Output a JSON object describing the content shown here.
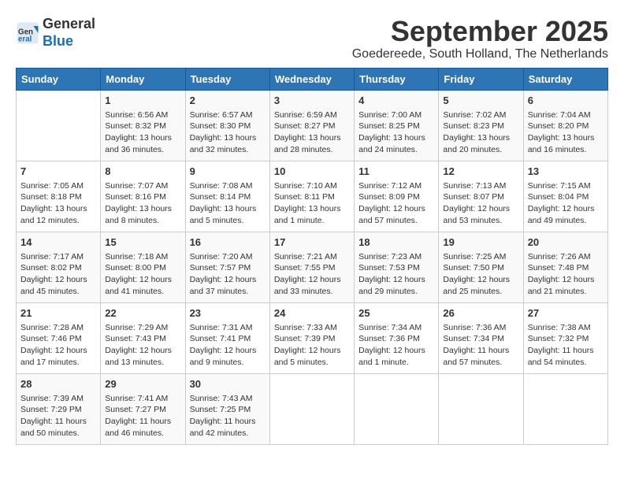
{
  "logo": {
    "general": "General",
    "blue": "Blue"
  },
  "header": {
    "month": "September 2025",
    "location": "Goedereede, South Holland, The Netherlands"
  },
  "weekdays": [
    "Sunday",
    "Monday",
    "Tuesday",
    "Wednesday",
    "Thursday",
    "Friday",
    "Saturday"
  ],
  "weeks": [
    [
      {
        "day": "",
        "info": ""
      },
      {
        "day": "1",
        "info": "Sunrise: 6:56 AM\nSunset: 8:32 PM\nDaylight: 13 hours\nand 36 minutes."
      },
      {
        "day": "2",
        "info": "Sunrise: 6:57 AM\nSunset: 8:30 PM\nDaylight: 13 hours\nand 32 minutes."
      },
      {
        "day": "3",
        "info": "Sunrise: 6:59 AM\nSunset: 8:27 PM\nDaylight: 13 hours\nand 28 minutes."
      },
      {
        "day": "4",
        "info": "Sunrise: 7:00 AM\nSunset: 8:25 PM\nDaylight: 13 hours\nand 24 minutes."
      },
      {
        "day": "5",
        "info": "Sunrise: 7:02 AM\nSunset: 8:23 PM\nDaylight: 13 hours\nand 20 minutes."
      },
      {
        "day": "6",
        "info": "Sunrise: 7:04 AM\nSunset: 8:20 PM\nDaylight: 13 hours\nand 16 minutes."
      }
    ],
    [
      {
        "day": "7",
        "info": "Sunrise: 7:05 AM\nSunset: 8:18 PM\nDaylight: 13 hours\nand 12 minutes."
      },
      {
        "day": "8",
        "info": "Sunrise: 7:07 AM\nSunset: 8:16 PM\nDaylight: 13 hours\nand 8 minutes."
      },
      {
        "day": "9",
        "info": "Sunrise: 7:08 AM\nSunset: 8:14 PM\nDaylight: 13 hours\nand 5 minutes."
      },
      {
        "day": "10",
        "info": "Sunrise: 7:10 AM\nSunset: 8:11 PM\nDaylight: 13 hours\nand 1 minute."
      },
      {
        "day": "11",
        "info": "Sunrise: 7:12 AM\nSunset: 8:09 PM\nDaylight: 12 hours\nand 57 minutes."
      },
      {
        "day": "12",
        "info": "Sunrise: 7:13 AM\nSunset: 8:07 PM\nDaylight: 12 hours\nand 53 minutes."
      },
      {
        "day": "13",
        "info": "Sunrise: 7:15 AM\nSunset: 8:04 PM\nDaylight: 12 hours\nand 49 minutes."
      }
    ],
    [
      {
        "day": "14",
        "info": "Sunrise: 7:17 AM\nSunset: 8:02 PM\nDaylight: 12 hours\nand 45 minutes."
      },
      {
        "day": "15",
        "info": "Sunrise: 7:18 AM\nSunset: 8:00 PM\nDaylight: 12 hours\nand 41 minutes."
      },
      {
        "day": "16",
        "info": "Sunrise: 7:20 AM\nSunset: 7:57 PM\nDaylight: 12 hours\nand 37 minutes."
      },
      {
        "day": "17",
        "info": "Sunrise: 7:21 AM\nSunset: 7:55 PM\nDaylight: 12 hours\nand 33 minutes."
      },
      {
        "day": "18",
        "info": "Sunrise: 7:23 AM\nSunset: 7:53 PM\nDaylight: 12 hours\nand 29 minutes."
      },
      {
        "day": "19",
        "info": "Sunrise: 7:25 AM\nSunset: 7:50 PM\nDaylight: 12 hours\nand 25 minutes."
      },
      {
        "day": "20",
        "info": "Sunrise: 7:26 AM\nSunset: 7:48 PM\nDaylight: 12 hours\nand 21 minutes."
      }
    ],
    [
      {
        "day": "21",
        "info": "Sunrise: 7:28 AM\nSunset: 7:46 PM\nDaylight: 12 hours\nand 17 minutes."
      },
      {
        "day": "22",
        "info": "Sunrise: 7:29 AM\nSunset: 7:43 PM\nDaylight: 12 hours\nand 13 minutes."
      },
      {
        "day": "23",
        "info": "Sunrise: 7:31 AM\nSunset: 7:41 PM\nDaylight: 12 hours\nand 9 minutes."
      },
      {
        "day": "24",
        "info": "Sunrise: 7:33 AM\nSunset: 7:39 PM\nDaylight: 12 hours\nand 5 minutes."
      },
      {
        "day": "25",
        "info": "Sunrise: 7:34 AM\nSunset: 7:36 PM\nDaylight: 12 hours\nand 1 minute."
      },
      {
        "day": "26",
        "info": "Sunrise: 7:36 AM\nSunset: 7:34 PM\nDaylight: 11 hours\nand 57 minutes."
      },
      {
        "day": "27",
        "info": "Sunrise: 7:38 AM\nSunset: 7:32 PM\nDaylight: 11 hours\nand 54 minutes."
      }
    ],
    [
      {
        "day": "28",
        "info": "Sunrise: 7:39 AM\nSunset: 7:29 PM\nDaylight: 11 hours\nand 50 minutes."
      },
      {
        "day": "29",
        "info": "Sunrise: 7:41 AM\nSunset: 7:27 PM\nDaylight: 11 hours\nand 46 minutes."
      },
      {
        "day": "30",
        "info": "Sunrise: 7:43 AM\nSunset: 7:25 PM\nDaylight: 11 hours\nand 42 minutes."
      },
      {
        "day": "",
        "info": ""
      },
      {
        "day": "",
        "info": ""
      },
      {
        "day": "",
        "info": ""
      },
      {
        "day": "",
        "info": ""
      }
    ]
  ]
}
